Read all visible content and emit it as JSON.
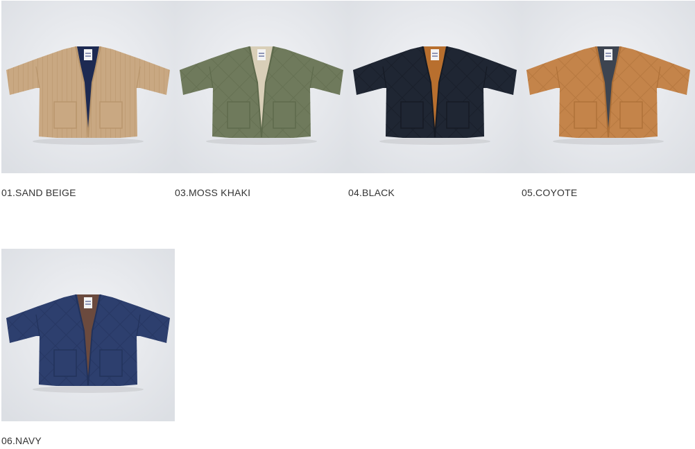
{
  "products": [
    {
      "label": "01.SAND BEIGE",
      "icon": "jacket-image",
      "body_color": "#c9a882",
      "shade_color": "#b8956c",
      "lining_color": "#1d2a52",
      "quilt": "vertical"
    },
    {
      "label": "03.MOSS KHAKI",
      "icon": "jacket-image",
      "body_color": "#6f7a5c",
      "shade_color": "#5e6a4c",
      "lining_color": "#d9cfb8",
      "quilt": "diamond"
    },
    {
      "label": "04.BLACK",
      "icon": "jacket-image",
      "body_color": "#1f2633",
      "shade_color": "#151a24",
      "lining_color": "#b86f2e",
      "quilt": "diamond"
    },
    {
      "label": "05.COYOTE",
      "icon": "jacket-image",
      "body_color": "#c4844a",
      "shade_color": "#ad7038",
      "lining_color": "#3d4450",
      "quilt": "diamond"
    },
    {
      "label": "06.NAVY",
      "icon": "jacket-image",
      "body_color": "#2d3f6e",
      "shade_color": "#22325b",
      "lining_color": "#6b4a3e",
      "quilt": "diamond"
    }
  ]
}
